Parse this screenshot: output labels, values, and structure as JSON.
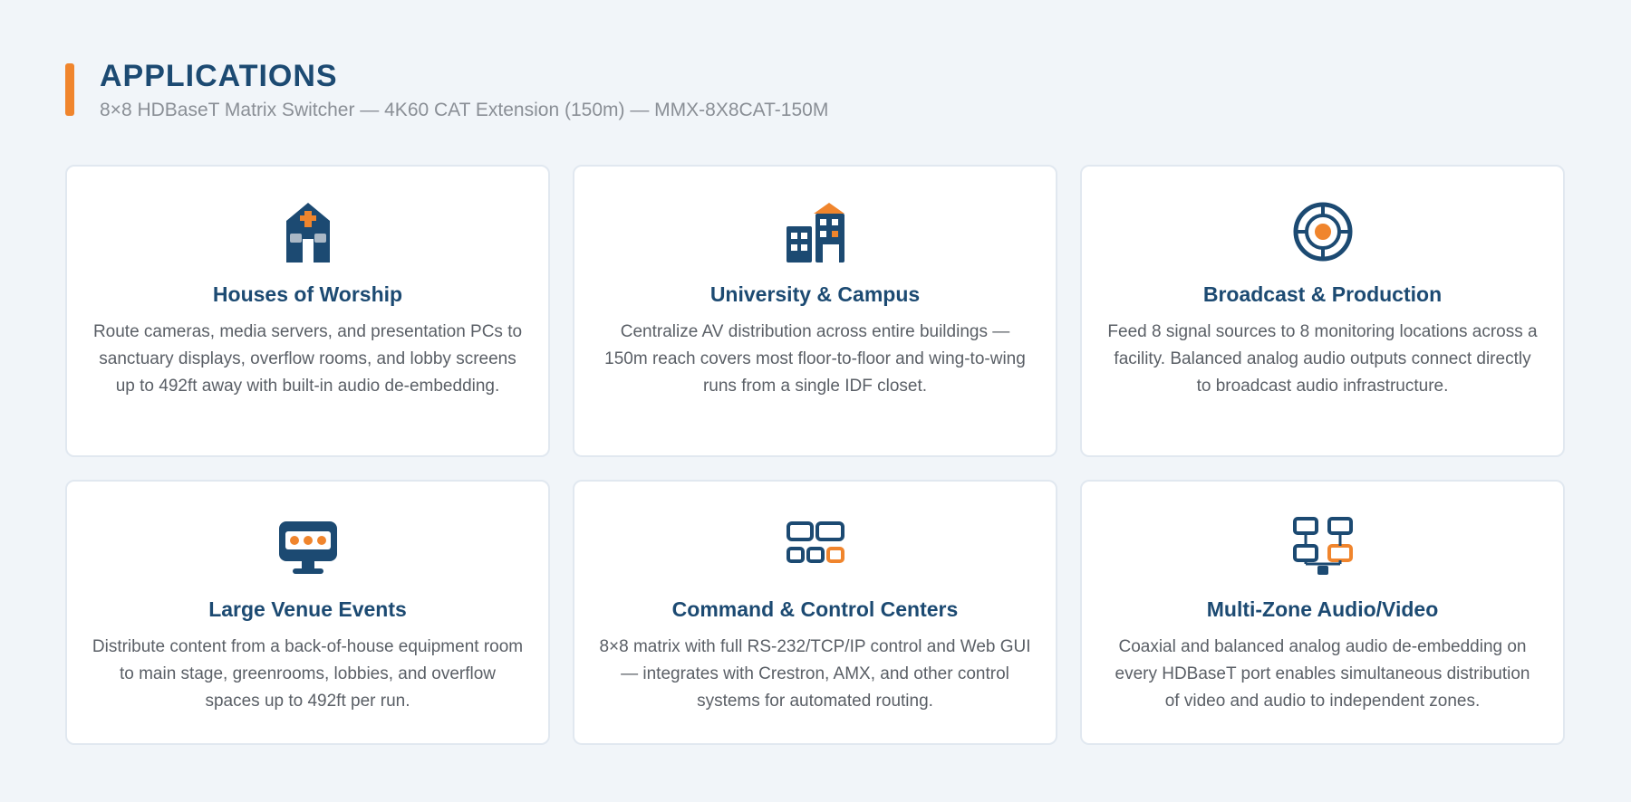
{
  "colors": {
    "accent": "#f0852d",
    "navy": "#1c4a72",
    "subtitle_gray": "#8a8f96",
    "text_gray": "#5a5f66",
    "background": "#f1f5f9",
    "card_border": "#e1e8f0"
  },
  "header": {
    "title": "APPLICATIONS",
    "subtitle": "8×8 HDBaseT Matrix Switcher — 4K60 CAT Extension (150m) — MMX-8X8CAT-150M"
  },
  "cards": [
    {
      "icon": "church-icon",
      "title": "Houses of Worship",
      "description": "Route cameras, media servers, and presentation PCs to sanctuary displays, overflow rooms, and lobby screens up to 492ft away with built-in audio de-embedding."
    },
    {
      "icon": "campus-buildings-icon",
      "title": "University & Campus",
      "description": "Centralize AV distribution across entire buildings — 150m reach covers most floor-to-floor and wing-to-wing runs from a single IDF closet."
    },
    {
      "icon": "target-icon",
      "title": "Broadcast & Production",
      "description": "Feed 8 signal sources to 8 monitoring locations across a facility. Balanced analog audio outputs connect directly to broadcast audio infrastructure."
    },
    {
      "icon": "monitor-icon",
      "title": "Large Venue Events",
      "description": "Distribute content from a back-of-house equipment room to main stage, greenrooms, lobbies, and overflow spaces up to 492ft per run."
    },
    {
      "icon": "control-grid-icon",
      "title": "Command & Control Centers",
      "description": "8×8 matrix with full RS-232/TCP/IP control and Web GUI — integrates with Crestron, AMX, and other control systems for automated routing."
    },
    {
      "icon": "network-zones-icon",
      "title": "Multi-Zone Audio/Video",
      "description": "Coaxial and balanced analog audio de-embedding on every HDBaseT port enables simultaneous distribution of video and audio to independent zones."
    }
  ]
}
